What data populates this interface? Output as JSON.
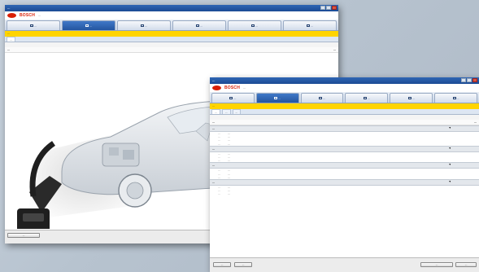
{
  "window1": {
    "title": "...",
    "brand": "BOSCH",
    "vehicle_info": "...",
    "tabs": [
      {
        "label": "..."
      },
      {
        "label": "..."
      },
      {
        "label": "..."
      },
      {
        "label": "..."
      },
      {
        "label": "..."
      },
      {
        "label": "..."
      }
    ],
    "status_text": "...",
    "subtab_label": "...",
    "page_title": "...",
    "header_right": "...",
    "checkbox_label": "...",
    "bottom_button": "..."
  },
  "window2": {
    "title": "...",
    "brand": "BOSCH",
    "vehicle_info": "...",
    "tabs": [
      {
        "label": "..."
      },
      {
        "label": "..."
      },
      {
        "label": "..."
      },
      {
        "label": "..."
      },
      {
        "label": "..."
      },
      {
        "label": "..."
      }
    ],
    "status_text": "...",
    "subtabs": [
      "...",
      "...",
      "..."
    ],
    "header_left": "...",
    "header_right": "...",
    "sections": [
      {
        "title": "...",
        "rows": [
          {
            "label": "...",
            "value": "..."
          },
          {
            "label": "...",
            "value": "..."
          },
          {
            "label": "...",
            "value": "..."
          },
          {
            "label": "...",
            "value": "..."
          }
        ]
      },
      {
        "title": "...",
        "rows": [
          {
            "label": "...",
            "value": "..."
          },
          {
            "label": "...",
            "value": "..."
          },
          {
            "label": "...",
            "value": "..."
          }
        ]
      },
      {
        "title": "...",
        "rows": [
          {
            "label": "...",
            "value": "..."
          },
          {
            "label": "...",
            "value": "..."
          },
          {
            "label": "...",
            "value": "..."
          }
        ]
      },
      {
        "title": "...",
        "rows": [
          {
            "label": "...",
            "value": "..."
          },
          {
            "label": "...",
            "value": "..."
          },
          {
            "label": "...",
            "value": "..."
          }
        ]
      }
    ],
    "footer_buttons_left": [
      "...",
      "..."
    ],
    "footer_buttons_right": [
      "...",
      "..."
    ]
  }
}
